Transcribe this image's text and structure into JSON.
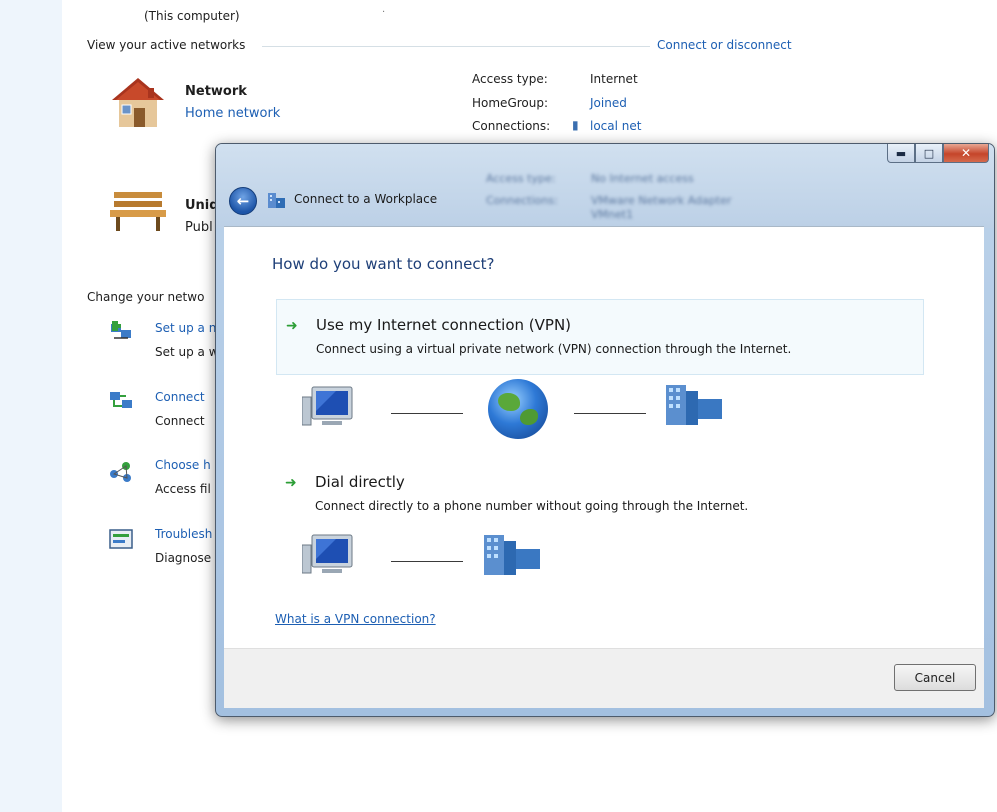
{
  "background": {
    "computer_label": "(This computer)",
    "section_title": "View your active networks",
    "connect_link": "Connect or disconnect",
    "network": {
      "name": "Network",
      "type": "Home network",
      "access_type_label": "Access type:",
      "access_type_value": "Internet",
      "homegroup_label": "HomeGroup:",
      "homegroup_value": "Joined",
      "connections_label": "Connections:",
      "connections_value": "local net"
    },
    "unidentified": {
      "name_partial": "Unid",
      "type_partial": "Publ",
      "access_type_label": "Access type:",
      "access_type_value": "No Internet access",
      "connections_label": "Connections:",
      "connections_value": "VMware Network Adapter",
      "connections_value2": "VMnet1"
    },
    "change_title_partial": "Change your netwo",
    "tasks": [
      {
        "link": "Set up a n",
        "desc": "Set up a w",
        "icon": "setup-connection-icon"
      },
      {
        "link": "Connect",
        "desc": "Connect",
        "icon": "connect-network-icon"
      },
      {
        "link": "Choose h",
        "desc": "Access fil",
        "icon": "homegroup-icon"
      },
      {
        "link": "Troublesh",
        "desc": "Diagnose",
        "icon": "troubleshoot-icon"
      }
    ]
  },
  "dialog": {
    "title": "Connect to a Workplace",
    "heading": "How do you want to connect?",
    "options": [
      {
        "title": "Use my Internet connection (VPN)",
        "desc": "Connect using a virtual private network (VPN) connection through the Internet."
      },
      {
        "title": "Dial directly",
        "desc": "Connect directly to a phone number without going through the Internet."
      }
    ],
    "help_link": "What is a VPN connection?",
    "cancel_label": "Cancel"
  },
  "colors": {
    "link": "#1d5fb3",
    "heading": "#1e3f78",
    "left_strip": "#eef5fc",
    "option_selected_bg": "#f4fafd",
    "arrow_green": "#2c9e36"
  }
}
